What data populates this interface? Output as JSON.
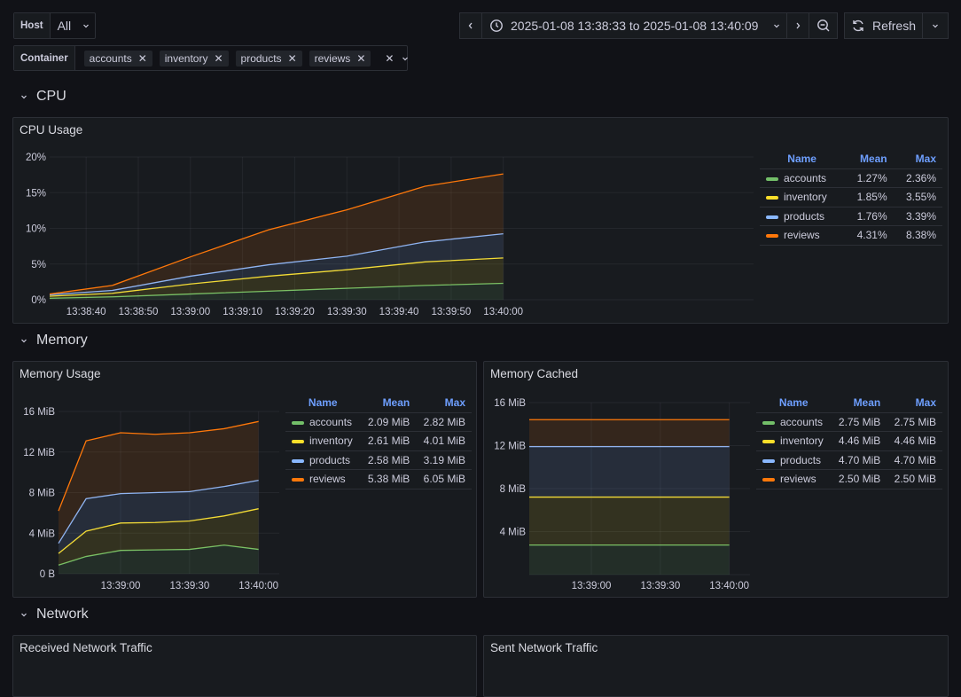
{
  "variables": {
    "host": {
      "label": "Host",
      "value": "All"
    },
    "container": {
      "label": "Container",
      "values": [
        "accounts",
        "inventory",
        "products",
        "reviews"
      ]
    }
  },
  "toolbar": {
    "time_range": "2025-01-08 13:38:33 to 2025-01-08 13:40:09",
    "refresh_label": "Refresh"
  },
  "icons": {
    "prev": "chevron-left-icon",
    "clock": "clock-icon",
    "next": "chevron-right-icon",
    "zoom_out": "zoom-out-icon",
    "refresh": "refresh-icon",
    "remove": "close-icon",
    "collapse": "chevron-down-icon"
  },
  "colors": {
    "accounts": "#73bf69",
    "inventory": "#fade2a",
    "products": "#8ab8ff",
    "reviews": "#ff780a",
    "legend_header": "#6e9fff"
  },
  "rows": {
    "cpu": "CPU",
    "memory": "Memory",
    "network": "Network"
  },
  "legend_headers": {
    "name": "Name",
    "mean": "Mean",
    "max": "Max"
  },
  "panels": {
    "cpu_usage": {
      "title": "CPU Usage",
      "legend": [
        {
          "name": "accounts",
          "mean": "1.27%",
          "max": "2.36%"
        },
        {
          "name": "inventory",
          "mean": "1.85%",
          "max": "3.55%"
        },
        {
          "name": "products",
          "mean": "1.76%",
          "max": "3.39%"
        },
        {
          "name": "reviews",
          "mean": "4.31%",
          "max": "8.38%"
        }
      ]
    },
    "memory_usage": {
      "title": "Memory Usage",
      "legend": [
        {
          "name": "accounts",
          "mean": "2.09 MiB",
          "max": "2.82 MiB"
        },
        {
          "name": "inventory",
          "mean": "2.61 MiB",
          "max": "4.01 MiB"
        },
        {
          "name": "products",
          "mean": "2.58 MiB",
          "max": "3.19 MiB"
        },
        {
          "name": "reviews",
          "mean": "5.38 MiB",
          "max": "6.05 MiB"
        }
      ]
    },
    "memory_cached": {
      "title": "Memory Cached",
      "legend": [
        {
          "name": "accounts",
          "mean": "2.75 MiB",
          "max": "2.75 MiB"
        },
        {
          "name": "inventory",
          "mean": "4.46 MiB",
          "max": "4.46 MiB"
        },
        {
          "name": "products",
          "mean": "4.70 MiB",
          "max": "4.70 MiB"
        },
        {
          "name": "reviews",
          "mean": "2.50 MiB",
          "max": "2.50 MiB"
        }
      ]
    },
    "received_network": {
      "title": "Received Network Traffic"
    },
    "sent_network": {
      "title": "Sent Network Traffic"
    }
  },
  "chart_data": [
    {
      "id": "cpu",
      "type": "area",
      "stacked": true,
      "title": "CPU Usage",
      "x": [
        "13:38:33",
        "13:38:45",
        "13:39:00",
        "13:39:15",
        "13:39:30",
        "13:39:45",
        "13:40:00"
      ],
      "x_seconds": [
        -87,
        -75,
        -60,
        -45,
        -30,
        -15,
        0
      ],
      "xlim_seconds": [
        -87,
        48
      ],
      "xticks": [
        {
          "s": -80,
          "label": "13:38:40"
        },
        {
          "s": -70,
          "label": "13:38:50"
        },
        {
          "s": -60,
          "label": "13:39:00"
        },
        {
          "s": -50,
          "label": "13:39:10"
        },
        {
          "s": -40,
          "label": "13:39:20"
        },
        {
          "s": -30,
          "label": "13:39:30"
        },
        {
          "s": -20,
          "label": "13:39:40"
        },
        {
          "s": -10,
          "label": "13:39:50"
        },
        {
          "s": 0,
          "label": "13:40:00"
        }
      ],
      "yticks": [
        {
          "v": 0,
          "label": "0%"
        },
        {
          "v": 5,
          "label": "5%"
        },
        {
          "v": 10,
          "label": "10%"
        },
        {
          "v": 15,
          "label": "15%"
        },
        {
          "v": 20,
          "label": "20%"
        }
      ],
      "ylim": [
        0,
        20
      ],
      "unit": "%",
      "legend": "right",
      "series": [
        {
          "name": "accounts",
          "values": [
            0.2,
            0.4,
            0.8,
            1.2,
            1.6,
            2.0,
            2.3
          ]
        },
        {
          "name": "inventory",
          "values": [
            0.3,
            0.5,
            1.4,
            2.1,
            2.6,
            3.3,
            3.55
          ]
        },
        {
          "name": "products",
          "values": [
            0.2,
            0.4,
            1.1,
            1.6,
            1.9,
            2.8,
            3.39
          ]
        },
        {
          "name": "reviews",
          "values": [
            0.1,
            0.7,
            2.7,
            4.9,
            6.5,
            7.8,
            8.38
          ]
        }
      ]
    },
    {
      "id": "memory_usage",
      "type": "area",
      "stacked": true,
      "title": "Memory Usage",
      "x": [
        "13:38:33",
        "13:38:45",
        "13:39:00",
        "13:39:15",
        "13:39:30",
        "13:39:45",
        "13:40:00"
      ],
      "x_seconds": [
        -87,
        -75,
        -60,
        -45,
        -30,
        -15,
        0
      ],
      "xlim_seconds": [
        -87,
        9
      ],
      "xticks": [
        {
          "s": -60,
          "label": "13:39:00"
        },
        {
          "s": -30,
          "label": "13:39:30"
        },
        {
          "s": 0,
          "label": "13:40:00"
        }
      ],
      "yticks": [
        {
          "v": 0,
          "label": "0 B"
        },
        {
          "v": 4,
          "label": "4 MiB"
        },
        {
          "v": 8,
          "label": "8 MiB"
        },
        {
          "v": 12,
          "label": "12 MiB"
        },
        {
          "v": 16,
          "label": "16 MiB"
        }
      ],
      "ylim": [
        0,
        16
      ],
      "unit": "MiB",
      "legend": "right",
      "series": [
        {
          "name": "accounts",
          "values": [
            0.85,
            1.7,
            2.3,
            2.35,
            2.4,
            2.82,
            2.4
          ]
        },
        {
          "name": "inventory",
          "values": [
            1.15,
            2.5,
            2.7,
            2.7,
            2.8,
            2.88,
            4.01
          ]
        },
        {
          "name": "products",
          "values": [
            1.0,
            3.2,
            2.9,
            2.95,
            2.9,
            2.9,
            2.8
          ]
        },
        {
          "name": "reviews",
          "values": [
            3.2,
            5.7,
            6.0,
            5.75,
            5.8,
            5.7,
            5.8
          ]
        }
      ]
    },
    {
      "id": "memory_cached",
      "type": "area",
      "stacked": true,
      "title": "Memory Cached",
      "x": [
        "13:38:33",
        "13:40:00"
      ],
      "x_seconds": [
        -87,
        0
      ],
      "xlim_seconds": [
        -87,
        9
      ],
      "xticks": [
        {
          "s": -60,
          "label": "13:39:00"
        },
        {
          "s": -30,
          "label": "13:39:30"
        },
        {
          "s": 0,
          "label": "13:40:00"
        }
      ],
      "yticks": [
        {
          "v": 4,
          "label": "4 MiB"
        },
        {
          "v": 8,
          "label": "8 MiB"
        },
        {
          "v": 12,
          "label": "12 MiB"
        },
        {
          "v": 16,
          "label": "16 MiB"
        }
      ],
      "ylim": [
        0,
        16
      ],
      "unit": "MiB",
      "legend": "right",
      "series": [
        {
          "name": "accounts",
          "values": [
            2.75,
            2.75
          ]
        },
        {
          "name": "inventory",
          "values": [
            4.46,
            4.46
          ]
        },
        {
          "name": "products",
          "values": [
            4.7,
            4.7
          ]
        },
        {
          "name": "reviews",
          "values": [
            2.5,
            2.5
          ]
        }
      ]
    }
  ]
}
